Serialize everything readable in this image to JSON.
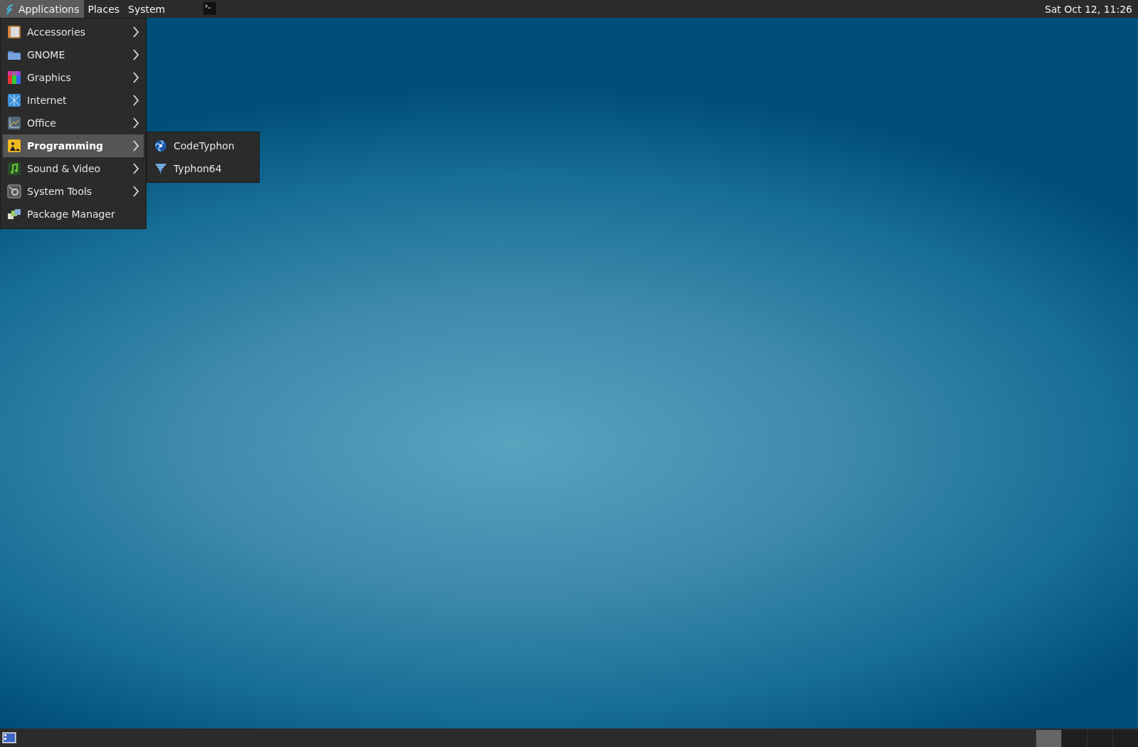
{
  "top_panel": {
    "menus": [
      {
        "label": "Applications",
        "selected": true
      },
      {
        "label": "Places",
        "selected": false
      },
      {
        "label": "System",
        "selected": false
      }
    ],
    "clock": "Sat Oct 12, 11:26"
  },
  "applications_menu": {
    "items": [
      {
        "label": "Accessories",
        "has_submenu": true,
        "selected": false
      },
      {
        "label": "GNOME",
        "has_submenu": true,
        "selected": false
      },
      {
        "label": "Graphics",
        "has_submenu": true,
        "selected": false
      },
      {
        "label": "Internet",
        "has_submenu": true,
        "selected": false
      },
      {
        "label": "Office",
        "has_submenu": true,
        "selected": false
      },
      {
        "label": "Programming",
        "has_submenu": true,
        "selected": true
      },
      {
        "label": "Sound & Video",
        "has_submenu": true,
        "selected": false
      },
      {
        "label": "System Tools",
        "has_submenu": true,
        "selected": false
      },
      {
        "label": "Package Manager",
        "has_submenu": false,
        "selected": false
      }
    ]
  },
  "submenu": {
    "items": [
      {
        "label": "CodeTyphon"
      },
      {
        "label": "Typhon64"
      }
    ]
  },
  "bottom_panel": {
    "workspaces": [
      {
        "selected": true
      },
      {
        "selected": false
      },
      {
        "selected": false
      },
      {
        "selected": false
      }
    ]
  }
}
